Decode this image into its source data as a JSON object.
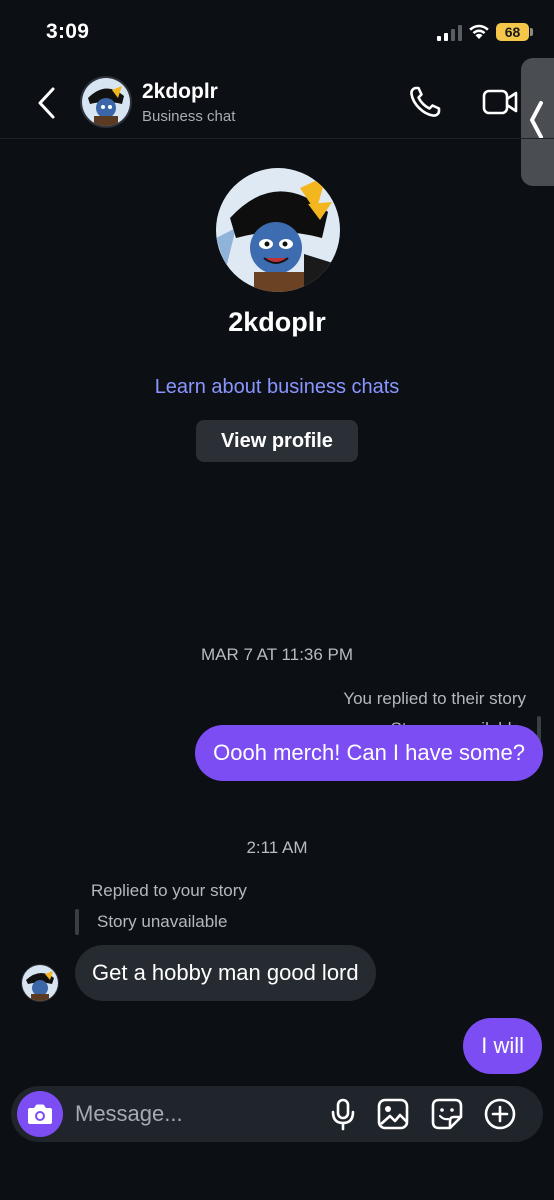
{
  "status": {
    "time": "3:09",
    "battery": "68"
  },
  "header": {
    "name": "2kdoplr",
    "subtitle": "Business chat",
    "icons": {
      "back": "chevron-left-icon",
      "call": "phone-icon",
      "video": "video-camera-icon",
      "side": "chevron-left-icon"
    }
  },
  "profile": {
    "name": "2kdoplr",
    "learn_link": "Learn about business chats",
    "view_profile": "View profile"
  },
  "chat": {
    "timestamp_1": "MAR 7 AT 11:36 PM",
    "out_reply_note": "You replied to their story",
    "out_story_status": "Story unavailable",
    "out_message_1": "Oooh merch! Can I have some?",
    "timestamp_2": "2:11 AM",
    "in_reply_note": "Replied to your story",
    "in_story_status": "Story unavailable",
    "in_message_1": "Get a hobby man good lord",
    "out_message_2": "I will"
  },
  "composer": {
    "placeholder": "Message...",
    "icons": [
      "camera-icon",
      "microphone-icon",
      "image-icon",
      "sticker-icon",
      "plus-circle-icon"
    ]
  },
  "colors": {
    "background": "#0c0f14",
    "accent_purple": "#7b4df2",
    "incoming_bubble": "#262a31",
    "link": "#8a96ff"
  }
}
